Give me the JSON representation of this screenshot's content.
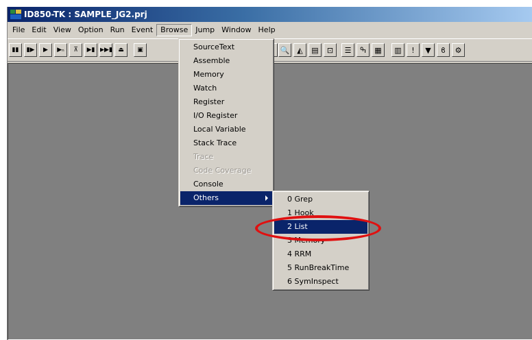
{
  "window": {
    "title": "ID850-TK : SAMPLE_JG2.prj",
    "icon": "app-icon"
  },
  "menubar": {
    "items": [
      {
        "label": "File"
      },
      {
        "label": "Edit"
      },
      {
        "label": "View"
      },
      {
        "label": "Option"
      },
      {
        "label": "Run"
      },
      {
        "label": "Event"
      },
      {
        "label": "Browse",
        "open": true
      },
      {
        "label": "Jump"
      },
      {
        "label": "Window"
      },
      {
        "label": "Help"
      }
    ]
  },
  "toolbar": {
    "buttons": [
      {
        "icon": "stop-icon",
        "glyph": "▮▮"
      },
      {
        "icon": "restart-icon",
        "glyph": "▮▶"
      },
      {
        "icon": "go-icon",
        "glyph": "▶"
      },
      {
        "icon": "go-n-icon",
        "glyph": "▶ₙ"
      },
      {
        "icon": "return-icon",
        "glyph": "⊼"
      },
      {
        "icon": "step-in-icon",
        "glyph": "▶▮"
      },
      {
        "icon": "step-over-icon",
        "glyph": "▶▶▮"
      },
      {
        "icon": "eject-icon",
        "glyph": "⏏"
      },
      {
        "icon": "window-icon",
        "glyph": "▣"
      },
      {
        "icon": "bug-icon",
        "glyph": "✱"
      },
      {
        "icon": "magnifier-icon",
        "glyph": "🔍"
      },
      {
        "icon": "graph-icon",
        "glyph": "◭"
      },
      {
        "icon": "chart-icon",
        "glyph": "▤"
      },
      {
        "icon": "inspect-icon",
        "glyph": "⊡"
      },
      {
        "icon": "list-icon",
        "glyph": "☰"
      },
      {
        "icon": "hook-icon",
        "glyph": "ߒ"
      },
      {
        "icon": "memory-icon",
        "glyph": "▦"
      },
      {
        "icon": "calculator-icon",
        "glyph": "▥"
      },
      {
        "icon": "exclamation-icon",
        "glyph": "!"
      },
      {
        "icon": "stop-sign-icon",
        "glyph": "▼"
      },
      {
        "icon": "footprint-icon",
        "glyph": "ϐ"
      },
      {
        "icon": "gear-icon",
        "glyph": "⚙"
      }
    ]
  },
  "browse_menu": {
    "items": [
      {
        "label": "SourceText",
        "enabled": true
      },
      {
        "label": "Assemble",
        "enabled": true
      },
      {
        "label": "Memory",
        "enabled": true
      },
      {
        "label": "Watch",
        "enabled": true
      },
      {
        "label": "Register",
        "enabled": true
      },
      {
        "label": "I/O Register",
        "enabled": true
      },
      {
        "label": "Local Variable",
        "enabled": true
      },
      {
        "label": "Stack Trace",
        "enabled": true
      },
      {
        "label": "Trace",
        "enabled": false
      },
      {
        "label": "Code Coverage",
        "enabled": false
      },
      {
        "label": "Console",
        "enabled": true
      },
      {
        "label": "Others",
        "enabled": true,
        "selected": true,
        "submenu": true
      }
    ]
  },
  "others_menu": {
    "items": [
      {
        "label": "0 Grep"
      },
      {
        "label": "1 Hook"
      },
      {
        "label": "2 List",
        "selected": true
      },
      {
        "label": "3 Memory"
      },
      {
        "label": "4 RRM"
      },
      {
        "label": "5 RunBreakTime"
      },
      {
        "label": "6 SymInspect"
      }
    ]
  },
  "colors": {
    "title_start": "#0a246a",
    "title_end": "#a6caf0",
    "menu_highlight": "#0a246a",
    "client_background": "#808080",
    "annotation_ellipse": "#e01010"
  }
}
